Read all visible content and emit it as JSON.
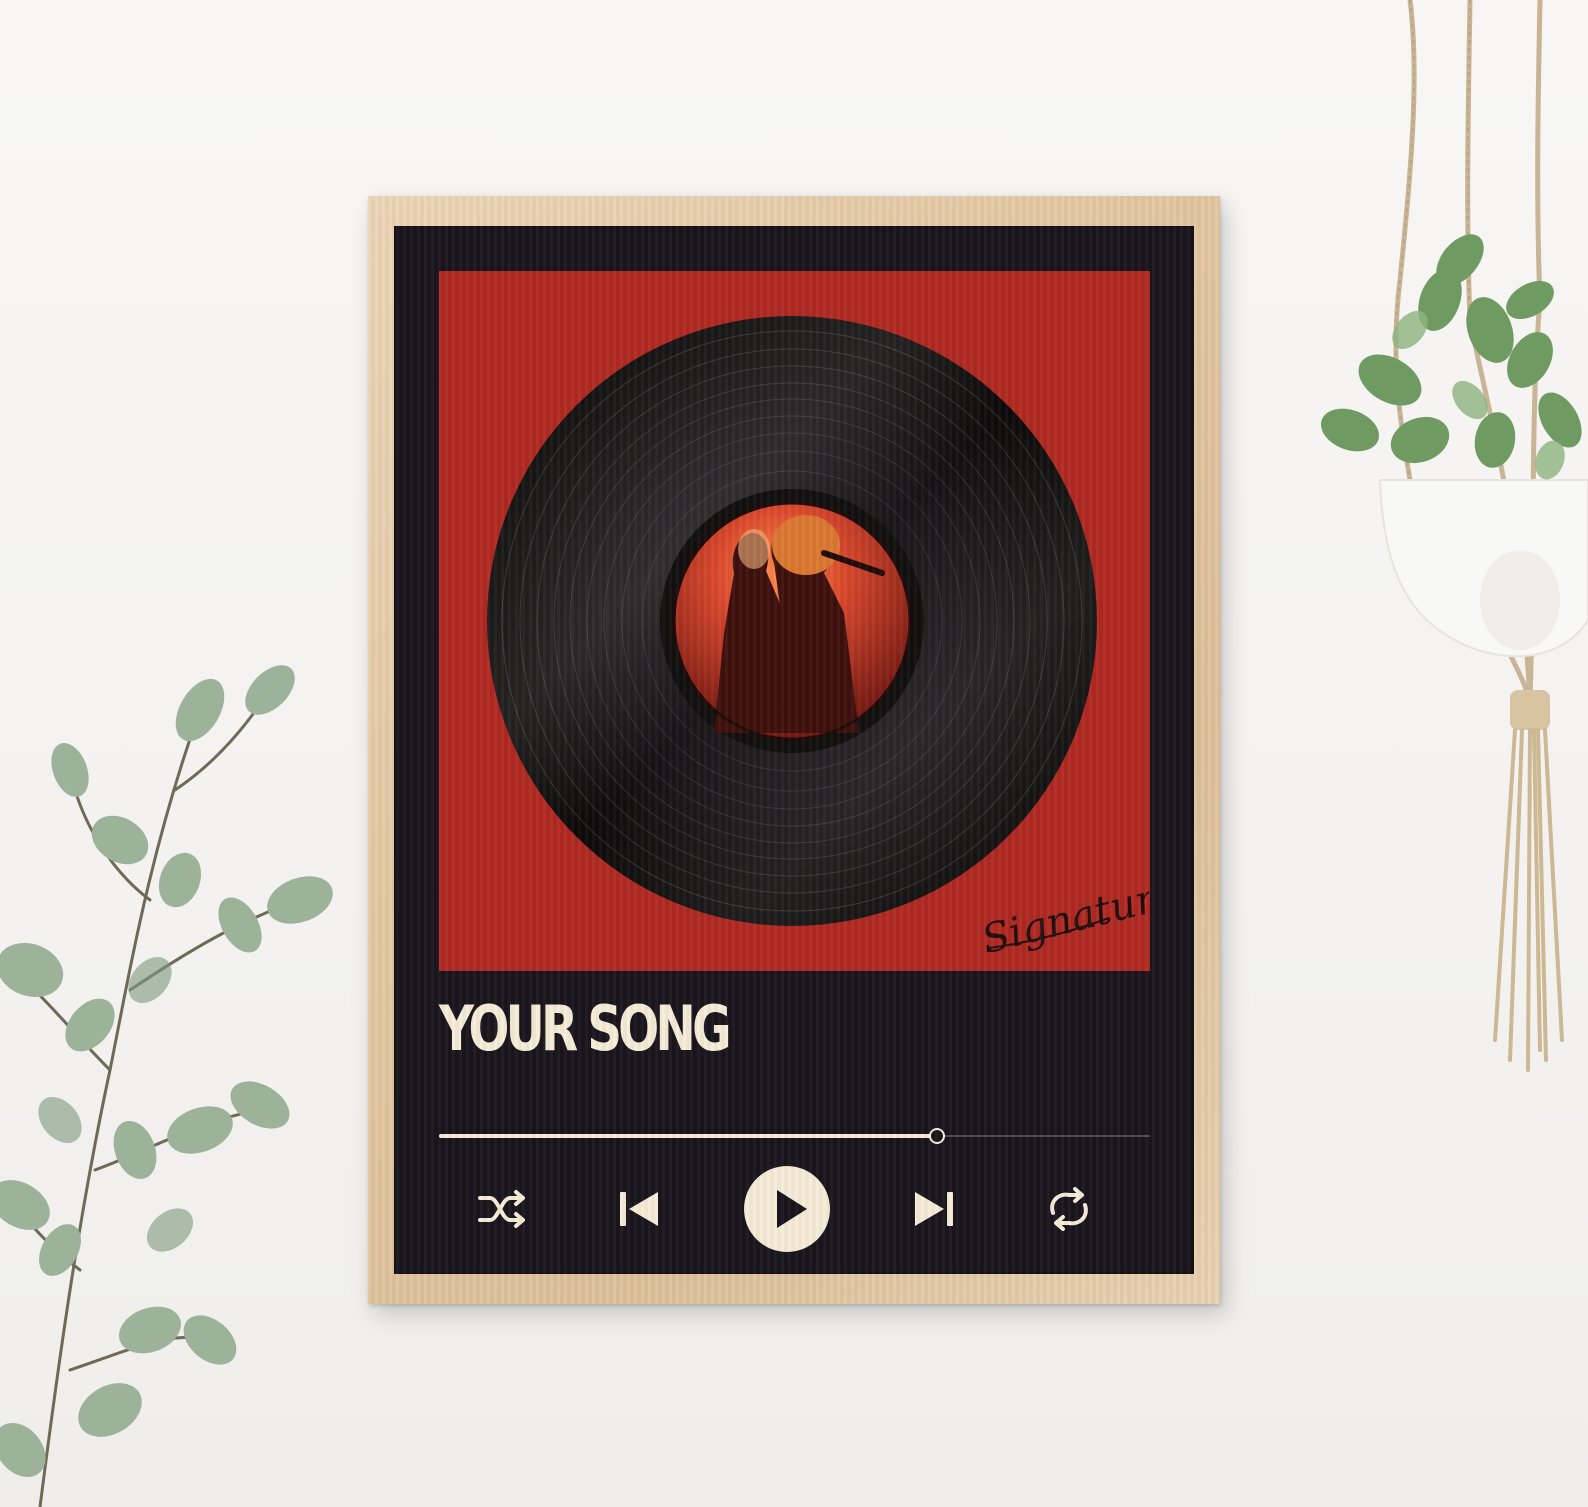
{
  "poster": {
    "song_title": "YOUR SONG",
    "signature_text": "Signature",
    "progress_fraction": 0.7,
    "colors": {
      "poster_background": "#15111a",
      "art_background": "#ae2620",
      "text": "#f4ecd8"
    },
    "controls": [
      {
        "name": "shuffle-icon"
      },
      {
        "name": "previous-track-icon"
      },
      {
        "name": "play-icon"
      },
      {
        "name": "next-track-icon"
      },
      {
        "name": "repeat-icon"
      }
    ]
  }
}
